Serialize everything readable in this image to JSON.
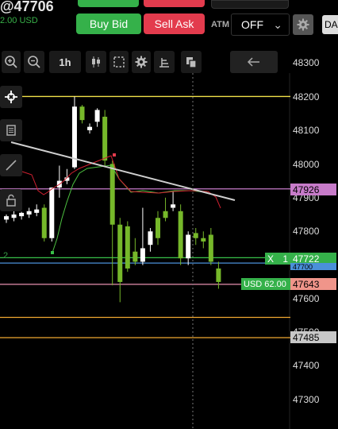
{
  "header": {
    "title": "@47706",
    "subtitle": "2.00 USD",
    "buy_bid_label": "Buy Bid",
    "sell_ask_label": "Sell Ask",
    "atm_label": "ATM",
    "atm_value": "OFF",
    "da_label": "DA"
  },
  "toolbar": {
    "timeframe_label": "1h"
  },
  "price_axis": {
    "labels": [
      "48300",
      "48200",
      "48100",
      "48000",
      "47900",
      "47800",
      "47700",
      "47600",
      "47500",
      "47400",
      "47300"
    ]
  },
  "price_tags": {
    "level_47926": "47926",
    "position_price": "47722",
    "position_x": "X",
    "position_qty": "1",
    "below_position": "47700",
    "pnl_label": "USD 62.00",
    "order_47643": "47643",
    "level_47485": "47485",
    "left_marker": "2"
  },
  "chart_data": {
    "type": "candlestick",
    "y_range": [
      47250,
      48360
    ],
    "horizontal_levels": [
      {
        "price": 48200,
        "color": "#f2e24a"
      },
      {
        "price": 47926,
        "color": "#c77bc9"
      },
      {
        "price": 47722,
        "color": "#38c048"
      },
      {
        "price": 47706,
        "color": "#4a90d9"
      },
      {
        "price": 47643,
        "color": "#e88fb0"
      },
      {
        "price": 47545,
        "color": "#f0a830"
      },
      {
        "price": 47485,
        "color": "#f0a830"
      }
    ],
    "candles": [
      {
        "o": 47835,
        "h": 47850,
        "l": 47825,
        "c": 47845
      },
      {
        "o": 47840,
        "h": 47860,
        "l": 47830,
        "c": 47850
      },
      {
        "o": 47845,
        "h": 47858,
        "l": 47835,
        "c": 47855
      },
      {
        "o": 47850,
        "h": 47870,
        "l": 47840,
        "c": 47860
      },
      {
        "o": 47855,
        "h": 47880,
        "l": 47845,
        "c": 47865
      },
      {
        "o": 47870,
        "h": 47880,
        "l": 47770,
        "c": 47780
      },
      {
        "o": 47780,
        "h": 47930,
        "l": 47770,
        "c": 47930
      },
      {
        "o": 47930,
        "h": 47995,
        "l": 47900,
        "c": 47950
      },
      {
        "o": 47950,
        "h": 47985,
        "l": 47940,
        "c": 47960
      },
      {
        "o": 47990,
        "h": 48200,
        "l": 47985,
        "c": 48170
      },
      {
        "o": 48170,
        "h": 48175,
        "l": 48120,
        "c": 48130
      },
      {
        "o": 48100,
        "h": 48120,
        "l": 48090,
        "c": 48110
      },
      {
        "o": 48125,
        "h": 48165,
        "l": 48110,
        "c": 48160
      },
      {
        "o": 48140,
        "h": 48160,
        "l": 47990,
        "c": 48010
      },
      {
        "o": 48000,
        "h": 48010,
        "l": 47640,
        "c": 47820
      },
      {
        "o": 47820,
        "h": 47840,
        "l": 47590,
        "c": 47650
      },
      {
        "o": 47815,
        "h": 47830,
        "l": 47680,
        "c": 47690
      },
      {
        "o": 47740,
        "h": 47780,
        "l": 47700,
        "c": 47710
      },
      {
        "o": 47710,
        "h": 47870,
        "l": 47700,
        "c": 47750
      },
      {
        "o": 47760,
        "h": 47810,
        "l": 47740,
        "c": 47800
      },
      {
        "o": 47840,
        "h": 47860,
        "l": 47760,
        "c": 47780
      },
      {
        "o": 47860,
        "h": 47900,
        "l": 47830,
        "c": 47840
      },
      {
        "o": 47870,
        "h": 47920,
        "l": 47860,
        "c": 47880
      },
      {
        "o": 47860,
        "h": 47880,
        "l": 47700,
        "c": 47720
      },
      {
        "o": 47720,
        "h": 47800,
        "l": 47700,
        "c": 47790
      },
      {
        "o": 47795,
        "h": 47810,
        "l": 47760,
        "c": 47780
      },
      {
        "o": 47780,
        "h": 47800,
        "l": 47750,
        "c": 47770
      },
      {
        "o": 47790,
        "h": 47810,
        "l": 47700,
        "c": 47710
      },
      {
        "o": 47690,
        "h": 47710,
        "l": 47630,
        "c": 47650
      }
    ]
  }
}
